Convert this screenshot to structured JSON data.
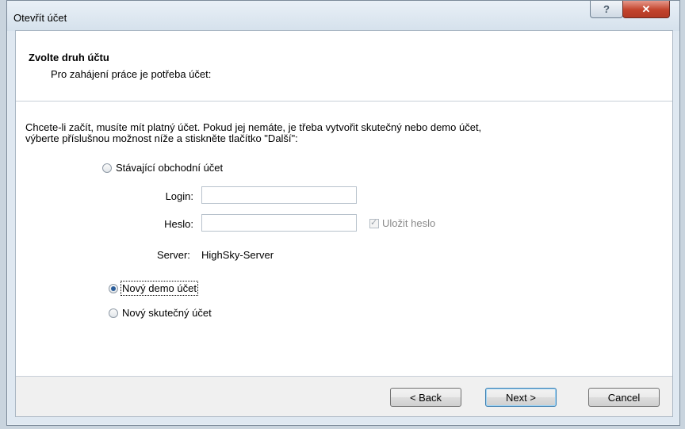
{
  "window": {
    "title": "Otevřít účet",
    "help_glyph": "?",
    "close_glyph": "✕"
  },
  "header": {
    "title": "Zvolte druh účtu",
    "subtitle": "Pro zahájení práce je potřeba účet:"
  },
  "body": {
    "intro_line1": "Chcete-li začít, musíte mít platný účet. Pokud jej nemáte, je třeba vytvořit skutečný nebo demo účet,",
    "intro_line2": "výberte příslušnou možnost níže a stiskněte tlačítko \"Další\":",
    "options": [
      {
        "label": "Stávající obchodní účet",
        "checked": false
      },
      {
        "label": "Nový demo účet",
        "checked": true
      },
      {
        "label": "Nový skutečný účet",
        "checked": false
      }
    ],
    "login_label": "Login:",
    "login_value": "",
    "password_label": "Heslo:",
    "password_value": "",
    "save_password_label": "Uložit heslo",
    "save_password_checked": true,
    "server_label": "Server:",
    "server_value": "HighSky-Server"
  },
  "footer": {
    "back_label": "< Back",
    "next_label": "Next >",
    "cancel_label": "Cancel"
  }
}
